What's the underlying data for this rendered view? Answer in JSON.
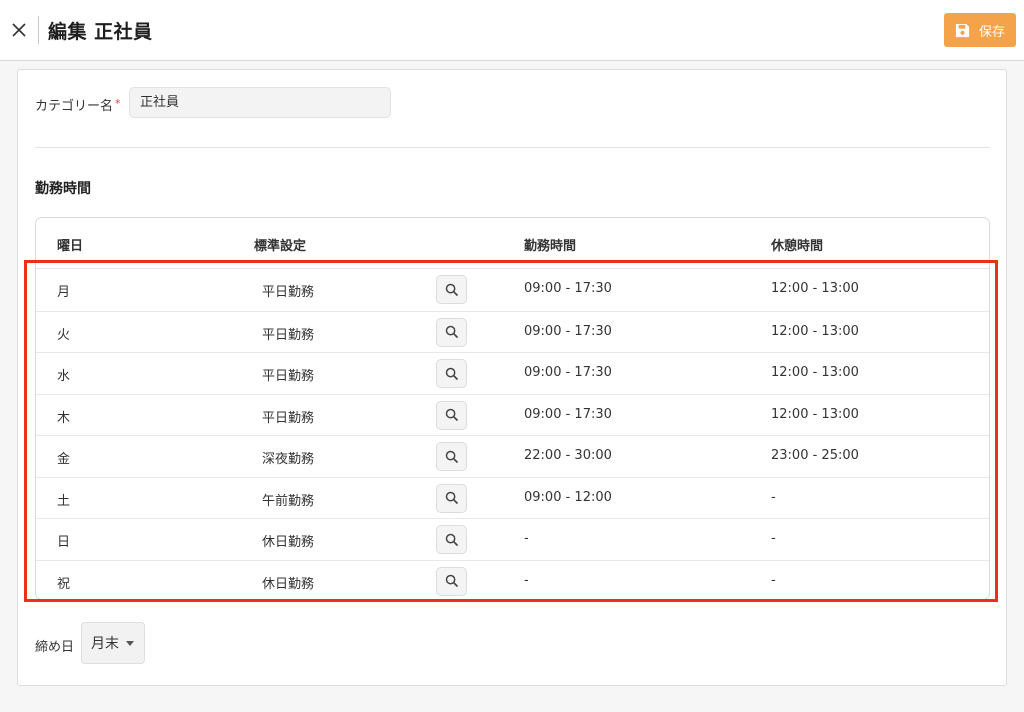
{
  "header": {
    "title": "編集 正社員",
    "save_label": "保存"
  },
  "category": {
    "label": "カテゴリー名",
    "required_mark": "*",
    "value": "正社員"
  },
  "work_hours": {
    "section_title": "勤務時間",
    "columns": {
      "day": "曜日",
      "standard": "標準設定",
      "work_time": "勤務時間",
      "break_time": "休憩時間"
    },
    "rows": [
      {
        "day": "月",
        "standard": "平日勤務",
        "work_time": "09:00 - 17:30",
        "break_time": "12:00 - 13:00"
      },
      {
        "day": "火",
        "standard": "平日勤務",
        "work_time": "09:00 - 17:30",
        "break_time": "12:00 - 13:00"
      },
      {
        "day": "水",
        "standard": "平日勤務",
        "work_time": "09:00 - 17:30",
        "break_time": "12:00 - 13:00"
      },
      {
        "day": "木",
        "standard": "平日勤務",
        "work_time": "09:00 - 17:30",
        "break_time": "12:00 - 13:00"
      },
      {
        "day": "金",
        "standard": "深夜勤務",
        "work_time": "22:00 - 30:00",
        "break_time": "23:00 - 25:00"
      },
      {
        "day": "土",
        "standard": "午前勤務",
        "work_time": "09:00 - 12:00",
        "break_time": "-"
      },
      {
        "day": "日",
        "standard": "休日勤務",
        "work_time": "-",
        "break_time": "-"
      },
      {
        "day": "祝",
        "standard": "休日勤務",
        "work_time": "-",
        "break_time": "-"
      }
    ]
  },
  "closing_day": {
    "label": "締め日",
    "value": "月末"
  },
  "colors": {
    "accent": "#f5a34a",
    "highlight": "#ee2d1b"
  }
}
